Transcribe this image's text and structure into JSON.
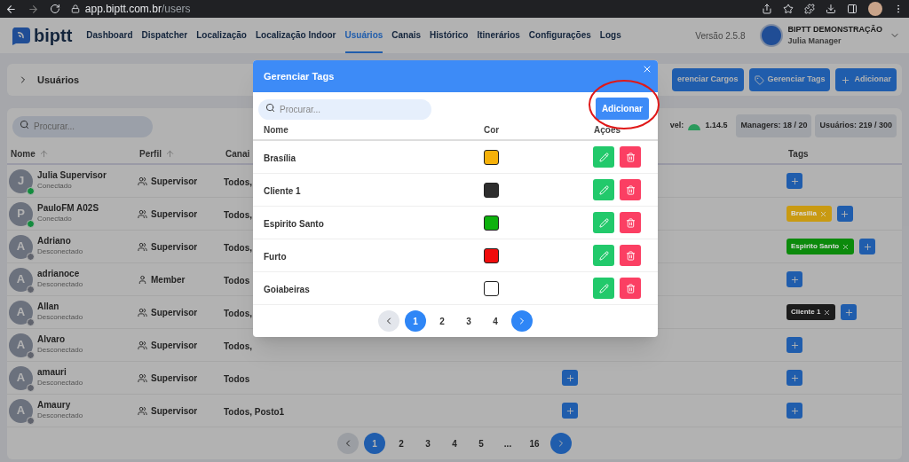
{
  "browser": {
    "host": "app.biptt.com.br",
    "path": "/users"
  },
  "app": {
    "logo": "biptt",
    "nav": [
      {
        "label": "Dashboard",
        "selected": false
      },
      {
        "label": "Dispatcher",
        "selected": false
      },
      {
        "label": "Localização",
        "selected": false
      },
      {
        "label": "Localização Indoor",
        "selected": false
      },
      {
        "label": "Usuários",
        "selected": true
      },
      {
        "label": "Canais",
        "selected": false
      },
      {
        "label": "Histórico",
        "selected": false
      },
      {
        "label": "Itinerários",
        "selected": false
      },
      {
        "label": "Configurações",
        "selected": false
      },
      {
        "label": "Logs",
        "selected": false
      }
    ],
    "version": "Versão 2.5.8",
    "account": {
      "org": "BIPTT DEMONSTRAÇÃO",
      "user": "Julia Manager"
    }
  },
  "page_header": {
    "title": "Usuários",
    "buttons": [
      {
        "label": "erenciar Cargos",
        "kind": "plain"
      },
      {
        "label": "Gerenciar Tags",
        "kind": "tag"
      },
      {
        "label": "Adicionar",
        "kind": "plus"
      }
    ]
  },
  "users": {
    "search": {
      "placeholder": "Procurar..."
    },
    "app_version": {
      "label": "vel:",
      "value": "1.14.5"
    },
    "chips": [
      "Managers: 18 / 20",
      "Usuários: 219 / 300"
    ],
    "columns": [
      {
        "label": "Nome",
        "sortable": true
      },
      {
        "label": "Perfil",
        "sortable": true
      },
      {
        "label": "Canai",
        "sortable": false
      },
      {
        "label": "Tags",
        "sortable": false
      }
    ],
    "rows": [
      {
        "initial": "J",
        "name": "Julia Supervisor",
        "status": "Conectado",
        "online": true,
        "profile": "Supervisor",
        "kind": "supervisor",
        "channels": "Todos,",
        "add_role": false,
        "tags": []
      },
      {
        "initial": "P",
        "name": "PauloFM A02S",
        "status": "Conectado",
        "online": true,
        "profile": "Supervisor",
        "kind": "supervisor",
        "channels": "Todos,",
        "add_role": false,
        "tags": [
          {
            "label": "Brasilia",
            "color": "#c99a12"
          }
        ]
      },
      {
        "initial": "A",
        "name": "Adriano",
        "status": "Desconectado",
        "online": false,
        "profile": "Supervisor",
        "kind": "supervisor",
        "channels": "Todos,",
        "add_role": false,
        "tags": [
          {
            "label": "Espirito Santo",
            "color": "#0c8a0c"
          }
        ]
      },
      {
        "initial": "A",
        "name": "adrianoce",
        "status": "Desconectado",
        "online": false,
        "profile": "Member",
        "kind": "member",
        "channels": "Todos",
        "add_role": false,
        "tags": []
      },
      {
        "initial": "A",
        "name": "Allan",
        "status": "Desconectado",
        "online": false,
        "profile": "Supervisor",
        "kind": "supervisor",
        "channels": "Todos,",
        "add_role": false,
        "tags": [
          {
            "label": "Cliente 1",
            "color": "#1c1c1c"
          }
        ]
      },
      {
        "initial": "A",
        "name": "Alvaro",
        "status": "Desconectado",
        "online": false,
        "profile": "Supervisor",
        "kind": "supervisor",
        "channels": "Todos,",
        "add_role": false,
        "tags": []
      },
      {
        "initial": "A",
        "name": "amauri",
        "status": "Desconectado",
        "online": false,
        "profile": "Supervisor",
        "kind": "supervisor",
        "channels": "Todos",
        "add_role": true,
        "tags": []
      },
      {
        "initial": "A",
        "name": "Amaury",
        "status": "Desconectado",
        "online": false,
        "profile": "Supervisor",
        "kind": "supervisor",
        "channels": "Todos, Posto1",
        "add_role": true,
        "tags": []
      }
    ],
    "pages": [
      {
        "label": "1",
        "selected": true
      },
      {
        "label": "2",
        "selected": false
      },
      {
        "label": "3",
        "selected": false
      },
      {
        "label": "4",
        "selected": false
      },
      {
        "label": "5",
        "selected": false
      },
      {
        "label": "...",
        "selected": false
      },
      {
        "label": "16",
        "selected": false
      }
    ]
  },
  "modal": {
    "title": "Gerenciar Tags",
    "search": {
      "placeholder": "Procurar..."
    },
    "add_label": "Adicionar",
    "columns": [
      "Nome",
      "Cor",
      "Ações"
    ],
    "rows": [
      {
        "name": "Brasília",
        "color": "#f6b10a"
      },
      {
        "name": "Cliente 1",
        "color": "#2e2e2e"
      },
      {
        "name": "Espirito Santo",
        "color": "#0db10d"
      },
      {
        "name": "Furto",
        "color": "#f00c0c"
      },
      {
        "name": "Goiabeiras",
        "color": "#ffffff"
      }
    ],
    "pages": [
      {
        "label": "1",
        "selected": true
      },
      {
        "label": "2",
        "selected": false
      },
      {
        "label": "3",
        "selected": false
      },
      {
        "label": "4",
        "selected": false
      }
    ]
  }
}
